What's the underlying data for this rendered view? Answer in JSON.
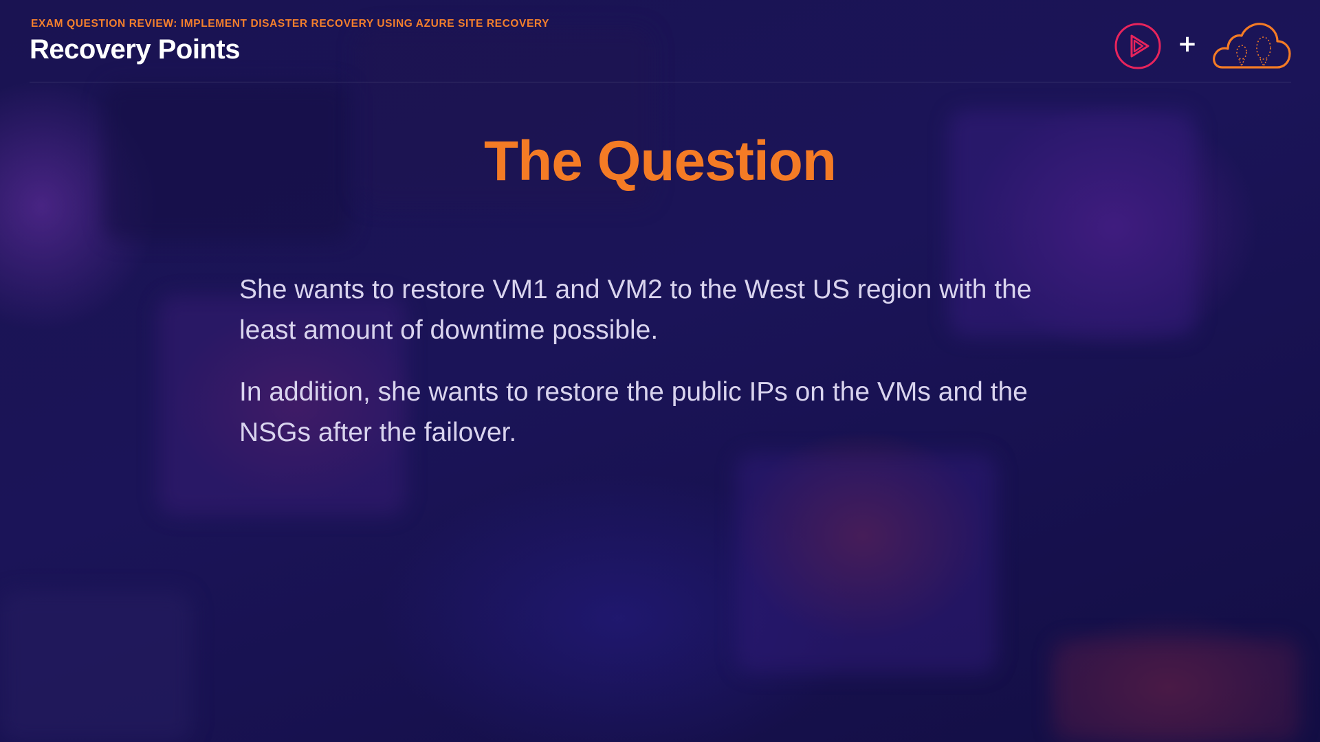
{
  "header": {
    "kicker": "EXAM QUESTION REVIEW: IMPLEMENT DISASTER RECOVERY USING AZURE SITE RECOVERY",
    "title": "Recovery Points"
  },
  "logos": {
    "left_icon": "play-icon",
    "separator": "+",
    "right_icon": "cloud-icon",
    "colors": {
      "play": "#e8245c",
      "cloud": "#f47b25"
    }
  },
  "slide": {
    "heading": "The Question",
    "paragraphs": [
      "She wants to restore VM1 and VM2 to the West US region with the least amount of downtime possible.",
      "In addition, she wants to restore the public IPs on the VMs and the NSGs after the failover."
    ]
  },
  "colors": {
    "accent": "#f47b25",
    "title": "#ffffff",
    "body_text": "#d9d4ee",
    "background": "#1a1352"
  }
}
